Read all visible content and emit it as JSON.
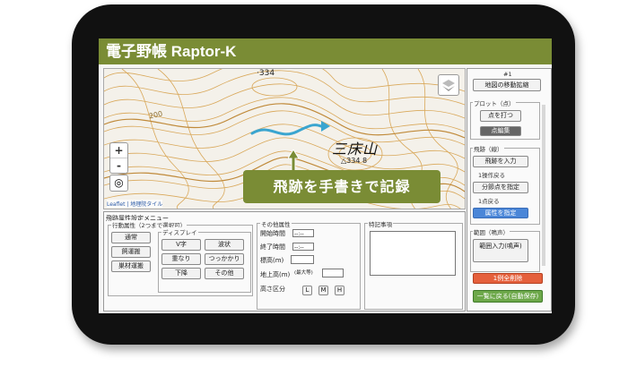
{
  "app": {
    "title": "電子野帳  Raptor-K"
  },
  "map": {
    "elevation_top": "·334",
    "contour_label": "200",
    "place_name": "三床山",
    "summit_label": "△334  8",
    "zoom_in": "+",
    "zoom_out": "-",
    "locate_icon": "◎",
    "attribution": "Leaflet | 地理院タイル",
    "track_color": "#3aa5d0"
  },
  "callout": {
    "text": "飛跡を手書きで記録"
  },
  "side_panel": {
    "record_no": "#1",
    "move_map_button": "地図の移動拡縮",
    "plot_group": "プロット（点）",
    "point_button": "点を打つ",
    "point_edit_button": "点編集",
    "track_group": "飛跡（線）",
    "track_input_button": "飛跡を入力",
    "undo1": "1操作戻る",
    "split_button": "分節点を指定",
    "undo2": "1点戻る",
    "attr_button": "属性を指定",
    "range_group": "範囲（鳴声）",
    "range_input_button": "範囲入力(鳴声)",
    "delete_button": "1例全削除",
    "back_button": "一覧に戻る(自動保存)"
  },
  "attr_form": {
    "title": "飛跡属性設定メニュー",
    "behavior_group": "行動属性（2つまで選択可）",
    "behavior_buttons": [
      "通常",
      "飼運搬",
      "巣材運搬"
    ],
    "display_group": "ディスプレイ",
    "display_buttons": [
      "V字",
      "波状",
      "重なり",
      "つっかかり",
      "下降",
      "その他"
    ],
    "other_group": "その他属性",
    "start_time_label": "開始時間",
    "end_time_label": "終了時間",
    "time_placeholder": "--:--",
    "altitude_label": "標高(m)",
    "ground_height_label": "地上高(m)",
    "ground_height_note": "(最大等)",
    "height_class_label": "高さ区分",
    "height_classes": [
      "L",
      "M",
      "H"
    ],
    "notes_label": "特記事項"
  }
}
